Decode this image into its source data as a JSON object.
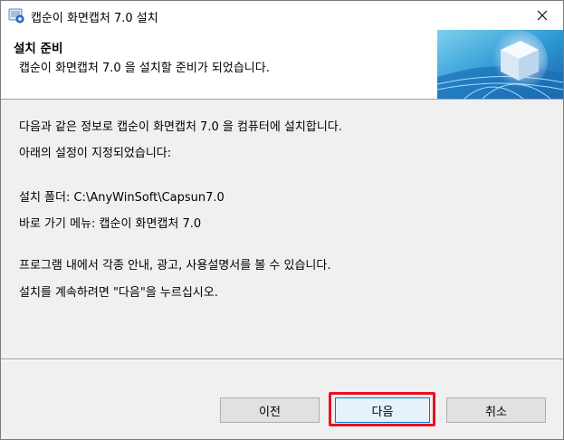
{
  "window": {
    "title": "캡순이 화면캡처 7.0 설치"
  },
  "header": {
    "title": "설치 준비",
    "subtitle": "캡순이 화면캡처 7.0 을 설치할 준비가 되었습니다."
  },
  "body": {
    "intro_line1": "다음과 같은 정보로 캡순이 화면캡처 7.0 을 컴퓨터에 설치합니다.",
    "intro_line2": "아래의 설정이 지정되었습니다:",
    "install_folder": "설치 폴더: C:\\AnyWinSoft\\Capsun7.0",
    "shortcut_menu": "바로 가기 메뉴: 캡순이 화면캡처 7.0",
    "info_line": "프로그램 내에서 각종 안내, 광고, 사용설명서를 볼 수 있습니다.",
    "continue_line": "설치를 계속하려면 \"다음\"을 누르십시오."
  },
  "buttons": {
    "prev": "이전",
    "next": "다음",
    "cancel": "취소"
  },
  "colors": {
    "highlight": "#e81123",
    "accent": "#0078d7"
  }
}
